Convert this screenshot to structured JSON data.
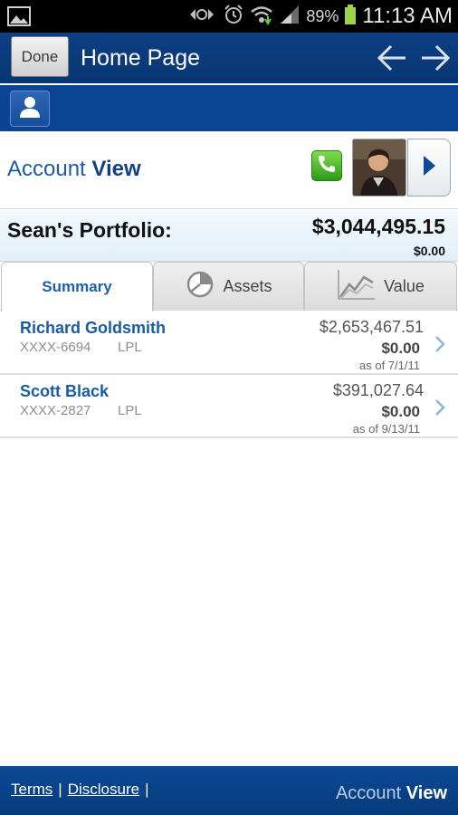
{
  "status_bar": {
    "battery": "89%",
    "time": "11:13 AM",
    "icons": [
      "image-icon",
      "signal-arrows-icon",
      "alarm-icon",
      "wifi-icon",
      "cell-signal-icon",
      "battery-icon"
    ]
  },
  "header": {
    "done_label": "Done",
    "title": "Home Page"
  },
  "account_view": {
    "logo_light": "Account ",
    "logo_bold": "View"
  },
  "portfolio": {
    "label": "Sean's Portfolio:",
    "total": "$3,044,495.15",
    "change": "$0.00"
  },
  "tabs": [
    {
      "label": "Summary",
      "active": true
    },
    {
      "label": "Assets",
      "icon": "pie-chart-icon"
    },
    {
      "label": "Value",
      "icon": "line-chart-icon"
    }
  ],
  "accounts": [
    {
      "name": "Richard Goldsmith",
      "number": "XXXX-6694",
      "firm": "LPL",
      "value": "$2,653,467.51",
      "change": "$0.00",
      "as_of": "as of 7/1/11"
    },
    {
      "name": "Scott Black",
      "number": "XXXX-2827",
      "firm": "LPL",
      "value": "$391,027.64",
      "change": "$0.00",
      "as_of": "as of 9/13/11"
    }
  ],
  "footer": {
    "terms": "Terms",
    "disclosure": "Disclosure",
    "sep": "|",
    "logo_light": "Account ",
    "logo_bold": "View"
  },
  "colors": {
    "header_blue": "#0b3f84",
    "link_blue": "#1a5ba6",
    "phone_green": "#3fb125"
  }
}
